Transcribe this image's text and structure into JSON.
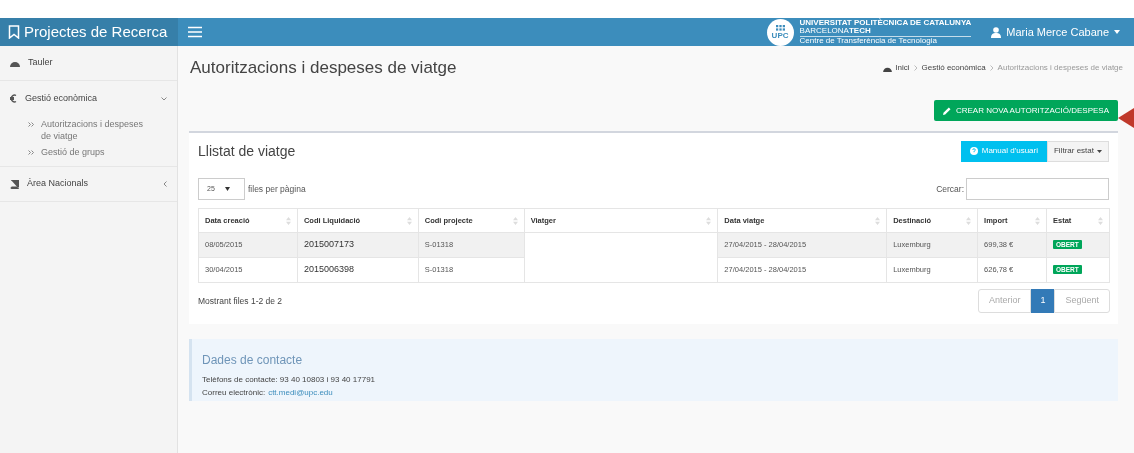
{
  "header": {
    "brand": "Projectes de Recerca",
    "logo": {
      "mark": "UPC",
      "line_1": "UNIVERSITAT POLITÈCNICA DE CATALUNYA",
      "line_2": "BARCELONA**TECH**",
      "line_3": "Centre de Transferència de Tecnologia"
    },
    "user": "Maria Merce Cabane"
  },
  "sidebar": {
    "items": [
      {
        "label": "Tauler"
      },
      {
        "label": "Gestió econòmica",
        "expanded": true,
        "children": [
          {
            "label": "Autoritzacions i despeses de viatge"
          },
          {
            "label": "Gestió de grups"
          }
        ]
      },
      {
        "label": "Àrea Nacionals",
        "expanded": false
      }
    ]
  },
  "page": {
    "title": "Autoritzacions i despeses de viatge",
    "breadcrumb": [
      "Inici",
      "Gestió econòmica",
      "Autoritzacions i despeses de viatge"
    ],
    "create_button": "CREAR NOVA AUTORITZACIÓ/DESPESA"
  },
  "list": {
    "title": "Llistat de viatge",
    "manual_button": "Manual d'usuari",
    "filter_button": "Filtrar estat",
    "page_size": "25",
    "page_size_label": "files per pàgina",
    "search_label": "Cercar:",
    "columns": [
      "Data creació",
      "Codi Liquidació",
      "Codi projecte",
      "Viatger",
      "Data viatge",
      "Destinació",
      "Import",
      "Estat"
    ],
    "rows": [
      {
        "date": "08/05/2015",
        "code": "2015007173",
        "project": "S-01318",
        "dates": "27/04/2015 - 28/04/2015",
        "destination": "Luxemburg",
        "amount": "699,38 €",
        "status": "OBERT"
      },
      {
        "date": "30/04/2015",
        "code": "2015006398",
        "project": "S-01318",
        "dates": "27/04/2015 - 28/04/2015",
        "destination": "Luxemburg",
        "amount": "626,78 €",
        "status": "OBERT"
      }
    ],
    "summary": "Mostrant files 1-2 de 2",
    "pagination": [
      {
        "label": "Anterior",
        "kind": "prev",
        "disabled": true
      },
      {
        "label": "1",
        "kind": "page",
        "selected": true
      },
      {
        "label": "Següent",
        "kind": "next",
        "disabled": true
      }
    ]
  },
  "contact": {
    "title": "Dades de contacte",
    "phones": "Telèfons de contacte: 93 40 10803 i 93 40 17791",
    "email_label": "Correu electrònic:",
    "email": "ctt.medi@upc.edu"
  }
}
